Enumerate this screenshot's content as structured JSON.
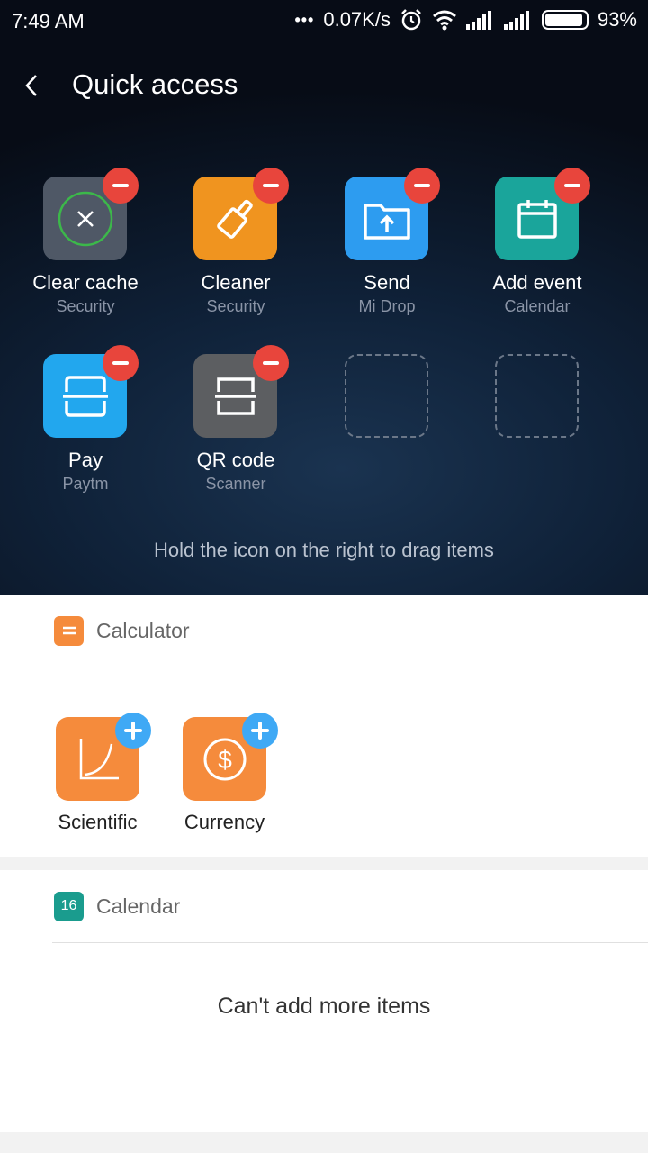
{
  "status": {
    "time": "7:49 AM",
    "speed": "0.07K/s",
    "battery": "93%"
  },
  "header": {
    "title": "Quick access"
  },
  "quick_items": [
    {
      "label": "Clear cache",
      "sub": "Security",
      "icon": "close-circle-icon",
      "color": "#4f5866"
    },
    {
      "label": "Cleaner",
      "sub": "Security",
      "icon": "brush-icon",
      "color": "#f0941f"
    },
    {
      "label": "Send",
      "sub": "Mi Drop",
      "icon": "folder-upload-icon",
      "color": "#2d9cf0"
    },
    {
      "label": "Add event",
      "sub": "Calendar",
      "icon": "calendar-icon",
      "color": "#1aa59b"
    },
    {
      "label": "Pay",
      "sub": "Paytm",
      "icon": "scan-icon",
      "color": "#22a7ee"
    },
    {
      "label": "QR code",
      "sub": "Scanner",
      "icon": "qr-scan-icon",
      "color": "#5c5e61"
    }
  ],
  "hint": "Hold the icon on the right to drag items",
  "calculator": {
    "title": "Calculator",
    "items": [
      {
        "label": "Scientific",
        "icon": "graph-icon"
      },
      {
        "label": "Currency",
        "icon": "dollar-icon"
      }
    ]
  },
  "calendar": {
    "title": "Calendar",
    "badge": "16",
    "message": "Can't add more items"
  }
}
